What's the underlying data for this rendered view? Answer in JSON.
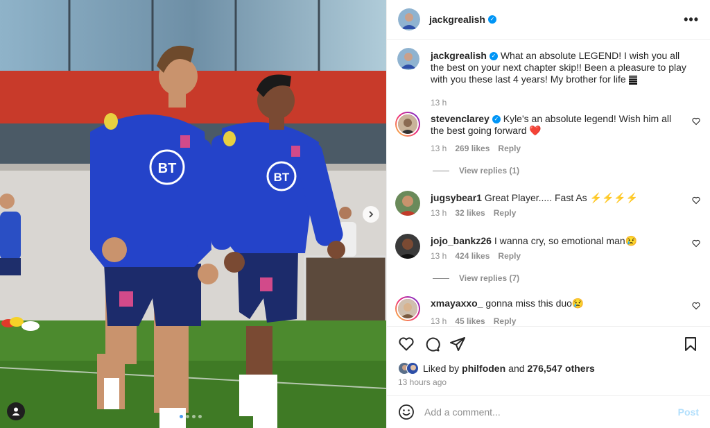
{
  "post": {
    "author": "jackgrealish",
    "more_icon_label": "•••"
  },
  "caption": {
    "username": "jackgrealish",
    "text": "What an absolute LEGEND! I wish you all the best on your next chapter skip!! Been a pleasure to play with you these last 4 years! My brother for life",
    "time": "13 h"
  },
  "comments": [
    {
      "username": "stevenclarey",
      "verified": true,
      "text": "Kyle's an absolute legend! Wish him all the best going forward ❤️",
      "time": "13 h",
      "likes": "269 likes",
      "reply": "Reply",
      "view_replies": "View replies (1)"
    },
    {
      "username": "jugsybear1",
      "verified": false,
      "text": "Great Player..... Fast As ⚡⚡⚡⚡",
      "time": "13 h",
      "likes": "32 likes",
      "reply": "Reply"
    },
    {
      "username": "jojo_bankz26",
      "verified": false,
      "text": "I wanna cry, so emotional man😢",
      "time": "13 h",
      "likes": "424 likes",
      "reply": "Reply",
      "view_replies": "View replies (7)"
    },
    {
      "username": "xmayaxxo_",
      "verified": false,
      "text": "gonna miss this duo😢",
      "time": "13 h",
      "likes": "45 likes",
      "reply": "Reply"
    }
  ],
  "likes": {
    "prefix": "Liked by",
    "user": "philfoden",
    "and": "and",
    "others": "276,547 others"
  },
  "timestamp": "13 hours ago",
  "add_comment": {
    "placeholder": "Add a comment...",
    "post_label": "Post"
  },
  "photo": {
    "jersey_logo": "BT",
    "carousel_count": 4,
    "carousel_active": 0
  },
  "colors": {
    "verified": "#0095f6",
    "post_disabled": "#b2dffc",
    "heart": "#e0245e"
  }
}
